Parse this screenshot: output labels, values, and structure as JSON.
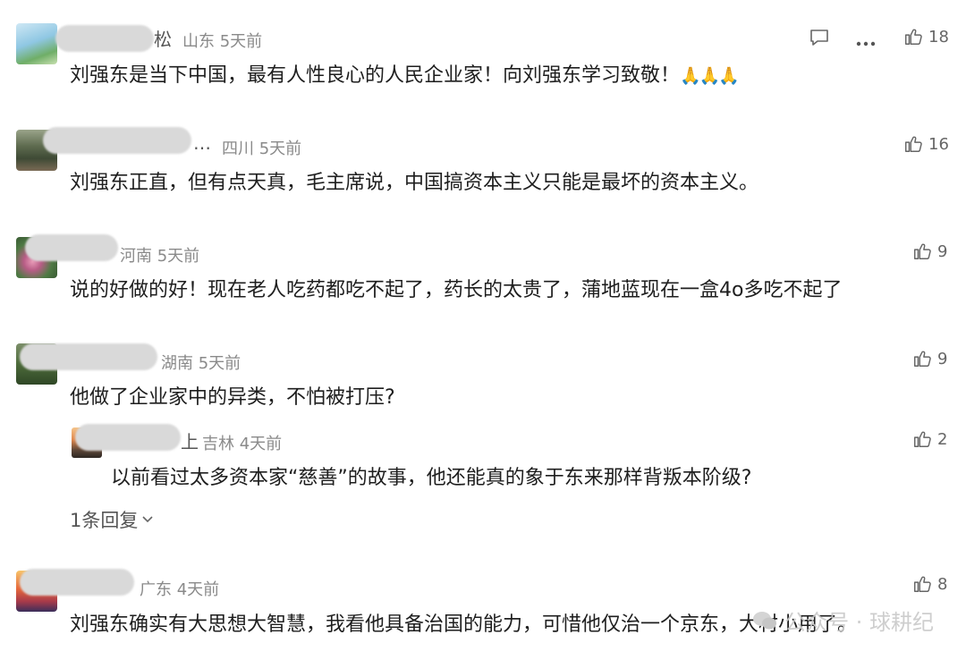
{
  "comments": [
    {
      "name_fragment": "松",
      "location": "山东",
      "time": "5天前",
      "text": "刘强东是当下中国，最有人性良心的人民企业家！向刘强东学习致敬！",
      "emoji": "🙏🙏🙏",
      "likes": "18"
    },
    {
      "name_fragment": "…",
      "location": "四川",
      "time": "5天前",
      "text": "刘强东正直，但有点天真，毛主席说，中国搞资本主义只能是最坏的资本主义。",
      "likes": "16"
    },
    {
      "name_fragment": "",
      "location": "河南",
      "time": "5天前",
      "text": "说的好做的好！现在老人吃药都吃不起了，药长的太贵了，蒲地蓝现在一盒4o多吃不起了",
      "likes": "9"
    },
    {
      "name_fragment": "",
      "location": "湖南",
      "time": "5天前",
      "text": "他做了企业家中的异类，不怕被打压?",
      "likes": "9"
    },
    {
      "name_fragment": "",
      "location": "广东",
      "time": "4天前",
      "text": "刘强东确实有大思想大智慧，我看他具备治国的能力，可惜他仅治一个京东，大材小用了。",
      "likes": "8"
    }
  ],
  "reply": {
    "name_fragment": "上",
    "location": "吉林",
    "time": "4天前",
    "text": "以前看过太多资本家“慈善”的故事，他还能真的象于东来那样背叛本阶级?",
    "likes": "2"
  },
  "more_replies_label": "1条回复",
  "watermark": "公众号 · 球耕纪",
  "icons": [
    "comment-icon",
    "more-icon",
    "thumbs-up-icon",
    "chevron-down-icon"
  ]
}
